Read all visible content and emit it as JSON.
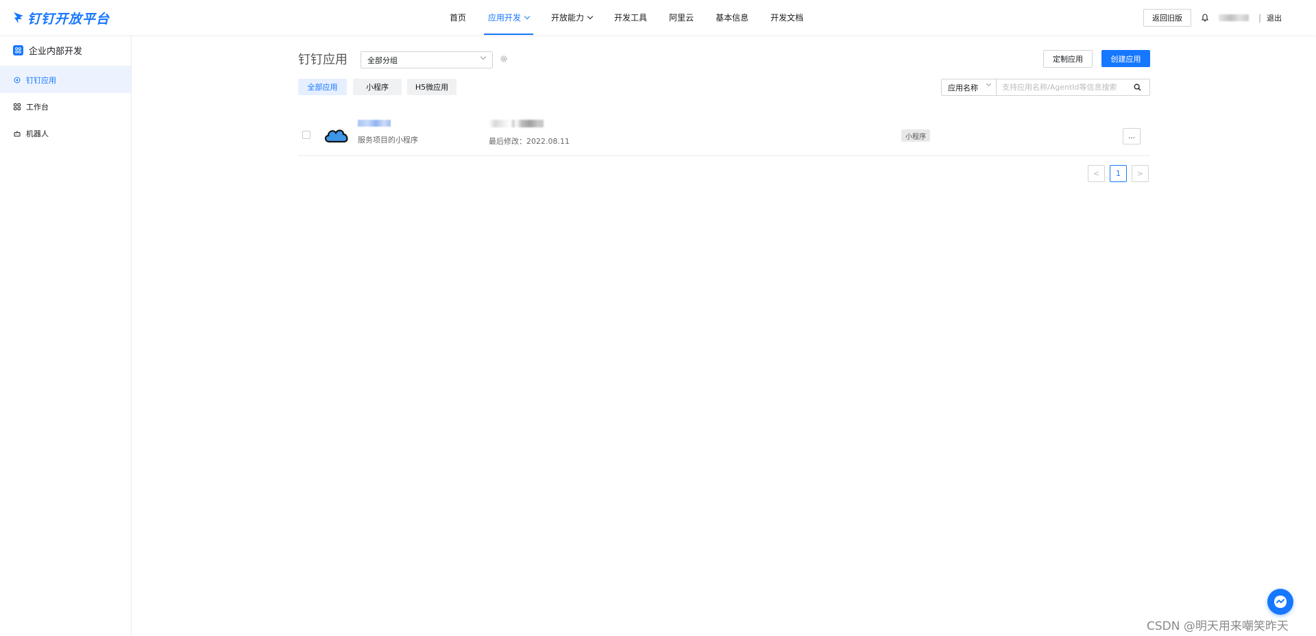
{
  "header": {
    "logo_text": "钉钉开放平台",
    "nav": [
      {
        "label": "首页"
      },
      {
        "label": "应用开发"
      },
      {
        "label": "开放能力"
      },
      {
        "label": "开发工具"
      },
      {
        "label": "阿里云"
      },
      {
        "label": "基本信息"
      },
      {
        "label": "开发文档"
      }
    ],
    "active_nav": "应用开发",
    "return_old_label": "返回旧版",
    "separator": "|",
    "logout_label": "退出"
  },
  "sidebar": {
    "title": "企业内部开发",
    "items": [
      {
        "label": "钉钉应用",
        "icon": "circle-dot-icon"
      },
      {
        "label": "工作台",
        "icon": "grid-icon"
      },
      {
        "label": "机器人",
        "icon": "robot-icon"
      }
    ],
    "active_item": "钉钉应用"
  },
  "main": {
    "page_title": "钉钉应用",
    "group_select_value": "全部分组",
    "custom_app_label": "定制应用",
    "create_app_label": "创建应用",
    "filter_tabs": [
      {
        "label": "全部应用"
      },
      {
        "label": "小程序"
      },
      {
        "label": "H5微应用"
      }
    ],
    "active_filter": "全部应用",
    "search_type_value": "应用名称",
    "search_placeholder": "支持应用名称/AgentId等信息搜索",
    "apps": [
      {
        "description": "服务项目的小程序",
        "modified": "最后修改：2022.08.11",
        "type_tag": "小程序",
        "more_label": "..."
      }
    ],
    "pagination": {
      "prev": "<",
      "current": "1",
      "next": ">"
    }
  },
  "watermark": "CSDN @明天用来嘲笑昨天",
  "colors": {
    "accent": "#1677ff",
    "active_bg": "#ecf3ff"
  }
}
